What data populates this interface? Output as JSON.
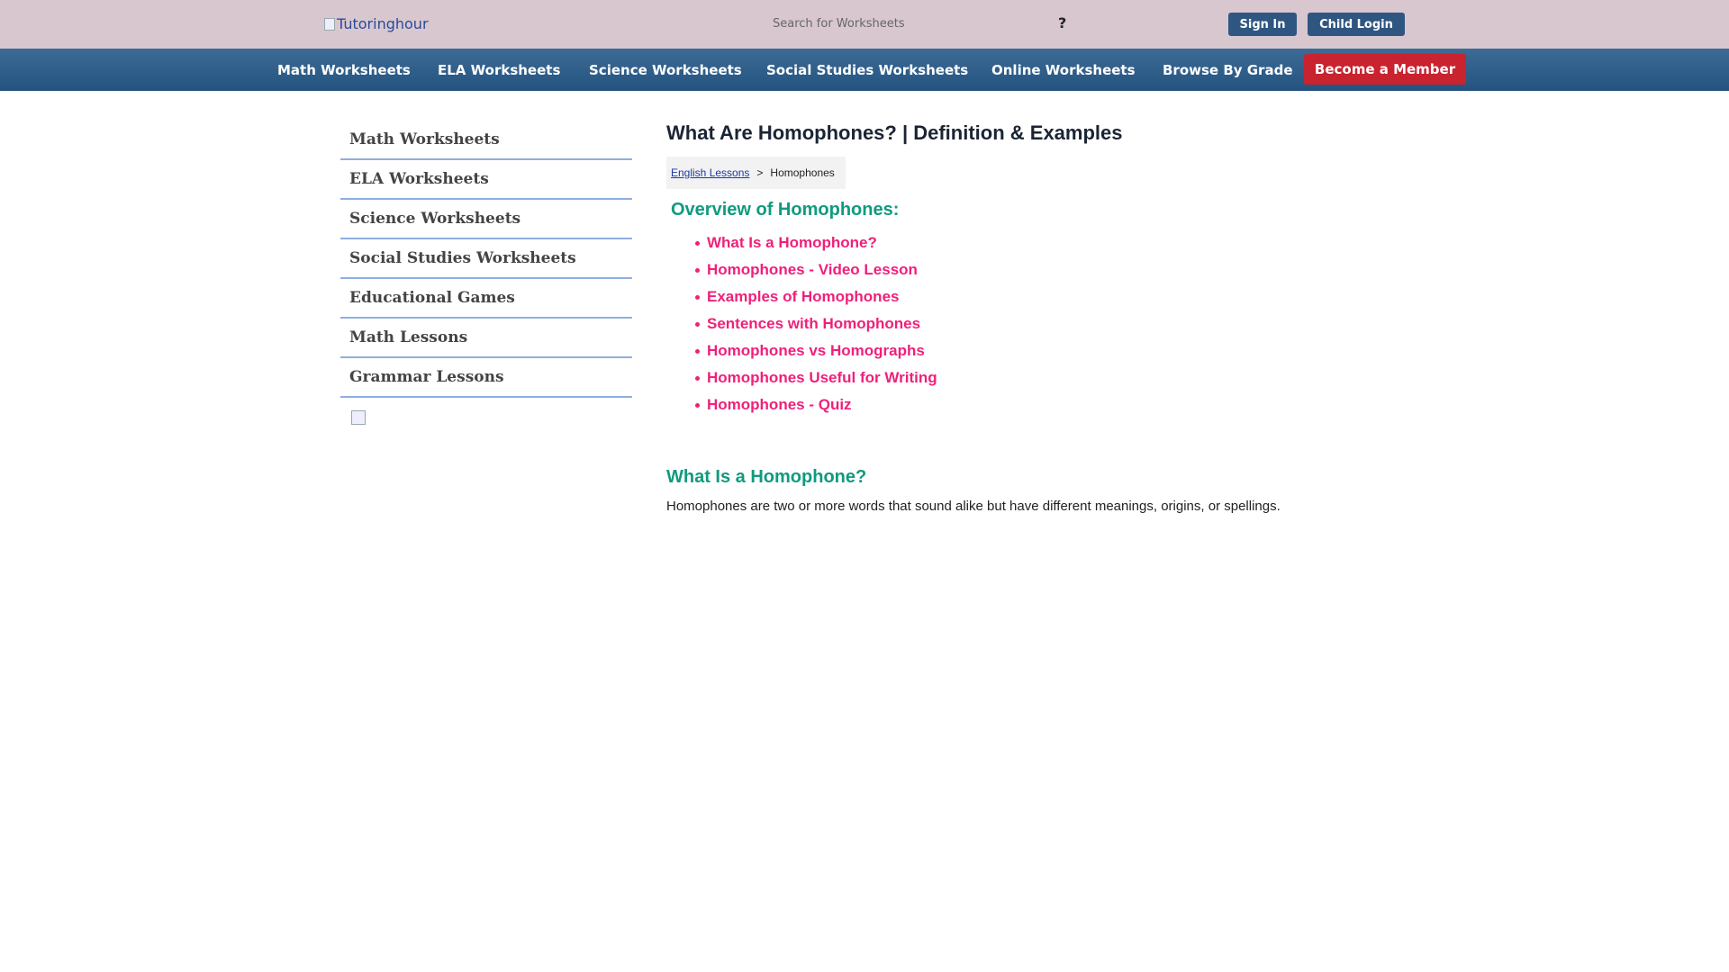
{
  "header": {
    "logo_alt": "Tutoringhour",
    "search_placeholder": "Search for Worksheets",
    "search_button": "?",
    "sign_in": "Sign In",
    "child_login": "Child Login"
  },
  "nav": {
    "items": [
      {
        "label": "Math Worksheets"
      },
      {
        "label": "ELA Worksheets"
      },
      {
        "label": "Science Worksheets"
      },
      {
        "label": "Social Studies Worksheets"
      },
      {
        "label": "Online Worksheets"
      },
      {
        "label": "Browse By Grade"
      }
    ],
    "member_button": "Become a Member"
  },
  "sidebar": {
    "items": [
      {
        "label": "Math Worksheets"
      },
      {
        "label": "ELA Worksheets"
      },
      {
        "label": "Science Worksheets"
      },
      {
        "label": "Social Studies Worksheets"
      },
      {
        "label": "Educational Games"
      },
      {
        "label": "Math Lessons"
      },
      {
        "label": "Grammar Lessons"
      }
    ]
  },
  "main": {
    "title": "What Are Homophones? | Definition & Examples",
    "breadcrumb": {
      "link": "English Lessons",
      "separator": ">",
      "current": "Homophones"
    },
    "overview_title": "Overview of Homophones:",
    "toc": [
      {
        "label": "What Is a Homophone?"
      },
      {
        "label": "Homophones - Video Lesson"
      },
      {
        "label": "Examples of Homophones"
      },
      {
        "label": "Sentences with Homophones"
      },
      {
        "label": "Homophones vs Homographs"
      },
      {
        "label": "Homophones Useful for Writing"
      },
      {
        "label": "Homophones - Quiz"
      }
    ],
    "section_heading": "What Is a Homophone?",
    "section_text": "Homophones are two or more words that sound alike but have different meanings, origins, or spellings."
  },
  "colors": {
    "header_bg": "#d8c7cf",
    "nav_bg": "#2d5c88",
    "member_red": "#c8232f",
    "link_pink": "#f0207a",
    "heading_green": "#109a7f"
  }
}
